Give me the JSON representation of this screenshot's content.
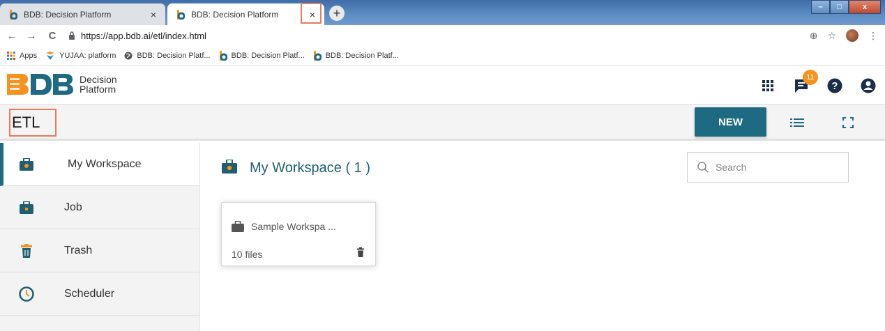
{
  "browser": {
    "tabs": [
      {
        "title": "BDB: Decision Platform",
        "close": "×"
      },
      {
        "title": "BDB: Decision Platform",
        "close": "×"
      }
    ],
    "new_tab": "+",
    "url": "https://app.bdb.ai/etl/index.html",
    "nav": {
      "back": "←",
      "forward": "→",
      "reload": "C"
    },
    "addr_right": {
      "zoom": "⊕",
      "star": "☆",
      "menu": "⋮"
    },
    "window_controls": {
      "minimize": "–",
      "maximize": "□",
      "close": "x"
    }
  },
  "bookmarks": [
    {
      "label": "Apps",
      "icon": "apps-grid-icon"
    },
    {
      "label": "YUJAA: platform",
      "icon": "yujaa-icon"
    },
    {
      "label": "BDB: Decision Platf...",
      "icon": "globe-icon"
    },
    {
      "label": "BDB: Decision Platf...",
      "icon": "bdb-icon"
    },
    {
      "label": "BDB: Decision Platf...",
      "icon": "bdb-icon"
    }
  ],
  "app": {
    "logo_line1": "Decision",
    "logo_line2": "Platform",
    "notification_count": "11",
    "section_title": "ETL",
    "new_button": "NEW",
    "accent": "#1e6a82",
    "badge_color": "#f6921e",
    "highlight_color": "#e97a5a"
  },
  "sidebar": {
    "items": [
      {
        "label": "My Workspace",
        "icon": "briefcase-icon",
        "active": true
      },
      {
        "label": "Job",
        "icon": "briefcase-icon",
        "active": false
      },
      {
        "label": "Trash",
        "icon": "trash-icon",
        "active": false
      },
      {
        "label": "Scheduler",
        "icon": "clock-icon",
        "active": false
      }
    ]
  },
  "main": {
    "title": "My Workspace ( 1 )",
    "search_placeholder": "Search",
    "cards": [
      {
        "name": "Sample Workspa ...",
        "files": "10 files"
      }
    ]
  }
}
